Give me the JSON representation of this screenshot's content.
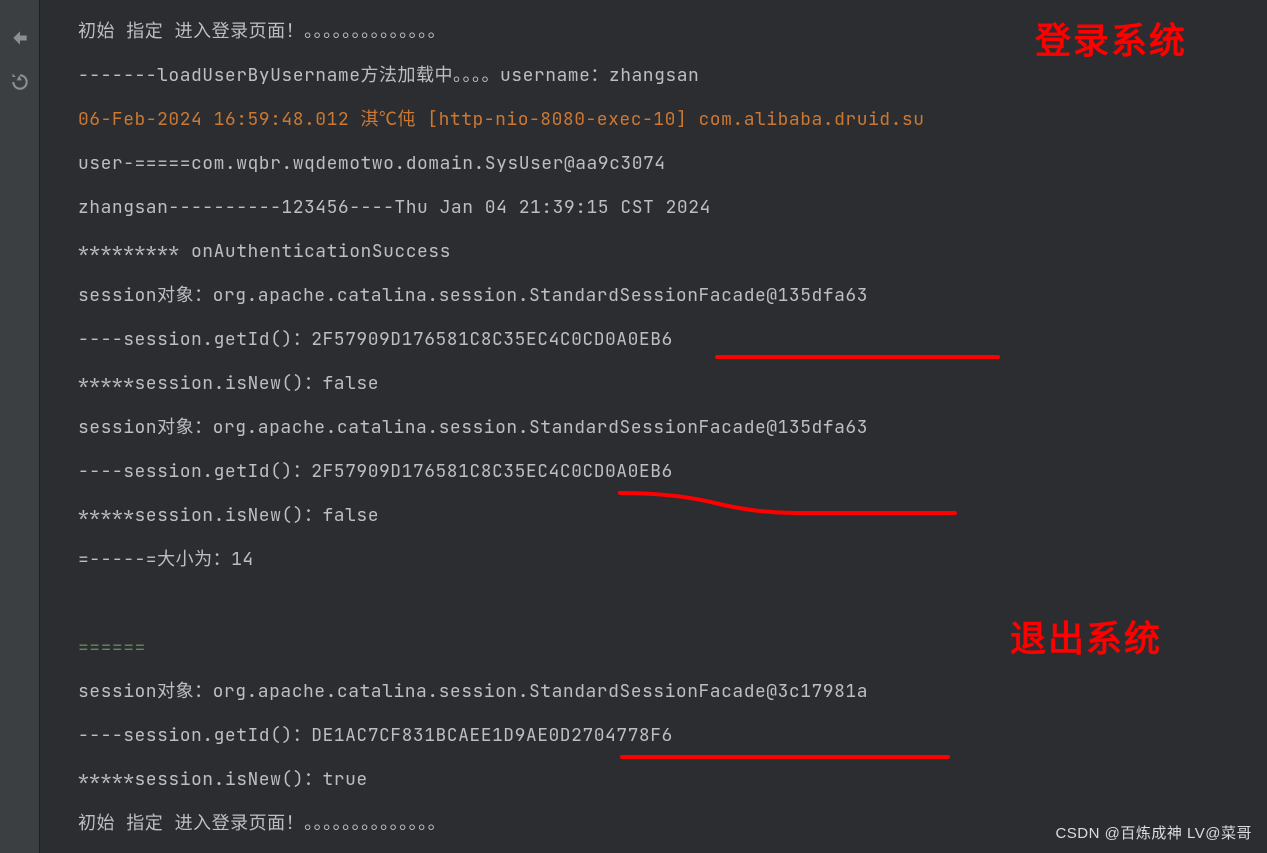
{
  "sidebar": {
    "icons": [
      "collapse-icon",
      "refresh-icon"
    ]
  },
  "console": {
    "lines": [
      {
        "cls": "normal",
        "text": "初始 指定 进入登录页面！。。。。。。。。。。。。。。"
      },
      {
        "cls": "normal",
        "text": "-------loadUserByUsername方法加载中。。。。username：zhangsan"
      },
      {
        "cls": "red-log",
        "text": "06-Feb-2024 16:59:48.012 淇℃伅 [http-nio-8080-exec-10] com.alibaba.druid.su"
      },
      {
        "cls": "normal",
        "text": "user-=====com.wqbr.wqdemotwo.domain.SysUser@aa9c3074"
      },
      {
        "cls": "normal",
        "text": "zhangsan----------123456----Thu Jan 04 21:39:15 CST 2024"
      },
      {
        "cls": "normal",
        "text": "********* onAuthenticationSuccess"
      },
      {
        "cls": "normal",
        "text": "session对象：org.apache.catalina.session.StandardSessionFacade@135dfa63"
      },
      {
        "cls": "normal",
        "text": "----session.getId()：2F57909D176581C8C35EC4C0CD0A0EB6"
      },
      {
        "cls": "normal",
        "text": "*****session.isNew()：false"
      },
      {
        "cls": "normal",
        "text": "session对象：org.apache.catalina.session.StandardSessionFacade@135dfa63"
      },
      {
        "cls": "normal",
        "text": "----session.getId()：2F57909D176581C8C35EC4C0CD0A0EB6"
      },
      {
        "cls": "normal",
        "text": "*****session.isNew()：false"
      },
      {
        "cls": "normal",
        "text": "=-----=大小为：14"
      },
      {
        "cls": "normal",
        "text": ""
      },
      {
        "cls": "green",
        "text": "======"
      },
      {
        "cls": "normal",
        "text": "session对象：org.apache.catalina.session.StandardSessionFacade@3c17981a"
      },
      {
        "cls": "normal",
        "text": "----session.getId()：DE1AC7CF831BCAEE1D9AE0D2704778F6"
      },
      {
        "cls": "normal",
        "text": "*****session.isNew()：true"
      },
      {
        "cls": "normal",
        "text": "初始 指定 进入登录页面！。。。。。。。。。。。。。。"
      }
    ]
  },
  "annotations": {
    "login": "登录系统",
    "logout": "退出系统"
  },
  "watermark": "CSDN @百炼成神 LV@菜哥"
}
